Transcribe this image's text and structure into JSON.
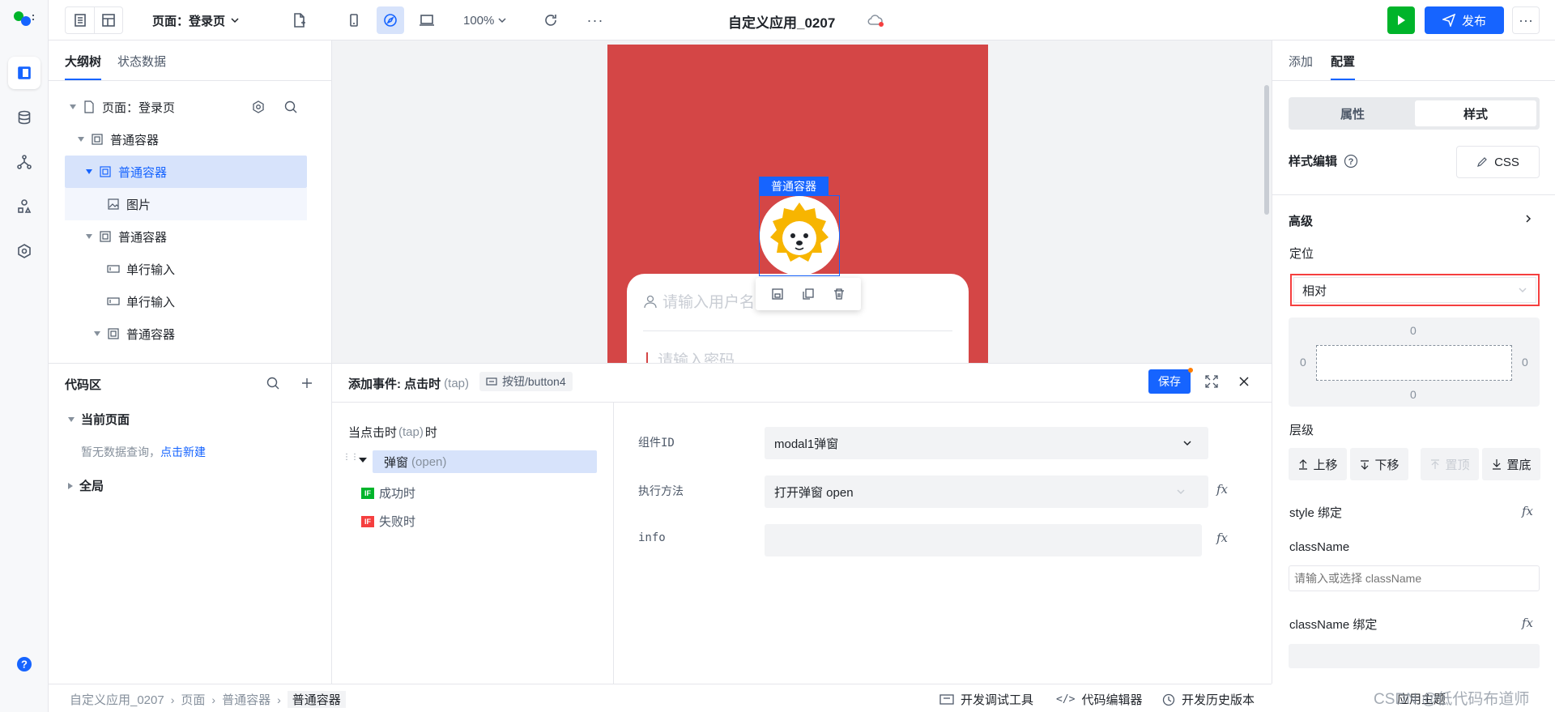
{
  "topbar": {
    "page_selector": "页面：登录页",
    "zoom": "100%",
    "app_title": "自定义应用_0207",
    "publish_label": "发布"
  },
  "outline": {
    "tabs": [
      "大纲树",
      "状态数据"
    ],
    "root": "页面：登录页",
    "nodes": [
      "普通容器",
      "普通容器",
      "图片",
      "普通容器",
      "单行输入",
      "单行输入",
      "普通容器"
    ]
  },
  "code_area": {
    "title": "代码区",
    "current_page": "当前页面",
    "empty_text": "暂无数据查询，",
    "create_link": "点击新建",
    "global": "全局"
  },
  "canvas": {
    "selection_label": "普通容器",
    "username_placeholder": "请输入用户名",
    "password_placeholder": "请输入密码"
  },
  "event_panel": {
    "title": "添加事件: 点击时",
    "title_event": "(tap)",
    "target": "按钮/button4",
    "save_label": "保存",
    "trigger_label": "当点击时",
    "trigger_event": "(tap)",
    "trigger_suffix": "时",
    "action_name": "弹窗",
    "action_method": "(open)",
    "success_label": "成功时",
    "fail_label": "失败时",
    "if_badge": "IF",
    "component_id_label": "组件ID",
    "component_id_value": "modal1弹窗",
    "method_label": "执行方法",
    "method_value": "打开弹窗 open",
    "info_label": "info",
    "fx": "fx"
  },
  "right_panel": {
    "tabs": [
      "添加",
      "配置"
    ],
    "seg": [
      "属性",
      "样式"
    ],
    "style_edit": "样式编辑",
    "css_button": "CSS",
    "advanced": "高级",
    "position_label": "定位",
    "position_value": "相对",
    "box": {
      "top": "0",
      "left": "0",
      "right": "0",
      "bottom": "0"
    },
    "layer_label": "层级",
    "layer_buttons": [
      "上移",
      "下移",
      "置顶",
      "置底"
    ],
    "style_bind": "style 绑定",
    "classname_label": "className",
    "classname_placeholder": "请输入或选择 className",
    "classname_bind": "className 绑定",
    "fx": "fx"
  },
  "bottom": {
    "breadcrumb": [
      "自定义应用_0207",
      "页面",
      "普通容器",
      "普通容器"
    ],
    "tools": [
      "开发调试工具",
      "代码编辑器",
      "开发历史版本"
    ],
    "apply_theme": "应用主题",
    "watermark": "CSDN @低代码布道师"
  },
  "colors": {
    "accent": "#1664ff",
    "canvas_red": "#d44646",
    "run_green": "#00b42a",
    "highlight_red": "#f53f3f"
  }
}
